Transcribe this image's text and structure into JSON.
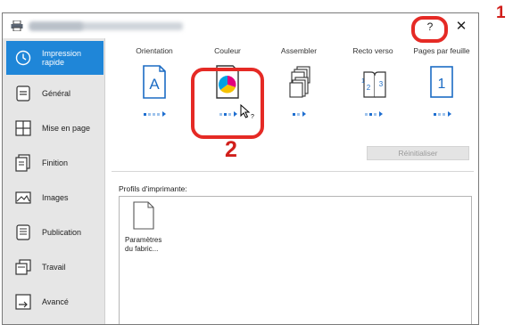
{
  "window": {
    "help_symbol": "?",
    "close_symbol": "✕"
  },
  "sidebar": {
    "items": [
      {
        "label": "Impression\nrapide",
        "icon": "clock-icon",
        "active": true
      },
      {
        "label": "Général",
        "icon": "document-lines-icon",
        "active": false
      },
      {
        "label": "Mise en page",
        "icon": "grid-layout-icon",
        "active": false
      },
      {
        "label": "Finition",
        "icon": "stacked-pages-icon",
        "active": false
      },
      {
        "label": "Images",
        "icon": "picture-icon",
        "active": false
      },
      {
        "label": "Publication",
        "icon": "booklet-icon",
        "active": false
      },
      {
        "label": "Travail",
        "icon": "job-stack-icon",
        "active": false
      },
      {
        "label": "Avancé",
        "icon": "advanced-arrow-icon",
        "active": false
      }
    ]
  },
  "features": [
    {
      "label": "Orientation",
      "icon": "portrait-a-icon"
    },
    {
      "label": "Couleur",
      "icon": "color-pie-icon"
    },
    {
      "label": "Assembler",
      "icon": "collate-icon"
    },
    {
      "label": "Recto verso",
      "icon": "duplex-icon"
    },
    {
      "label": "Pages par feuille",
      "icon": "pages-per-sheet-icon"
    }
  ],
  "reset_button": "Réinitialiser",
  "profiles": {
    "label": "Profils d'imprimante:",
    "items": [
      {
        "name": "Paramètres\ndu fabric..."
      }
    ]
  },
  "callouts": {
    "one": "1",
    "two": "2"
  },
  "colors": {
    "accent": "#1f86d8",
    "highlight_red": "#e52a25",
    "sidebar_bg": "#e6e6e6"
  }
}
